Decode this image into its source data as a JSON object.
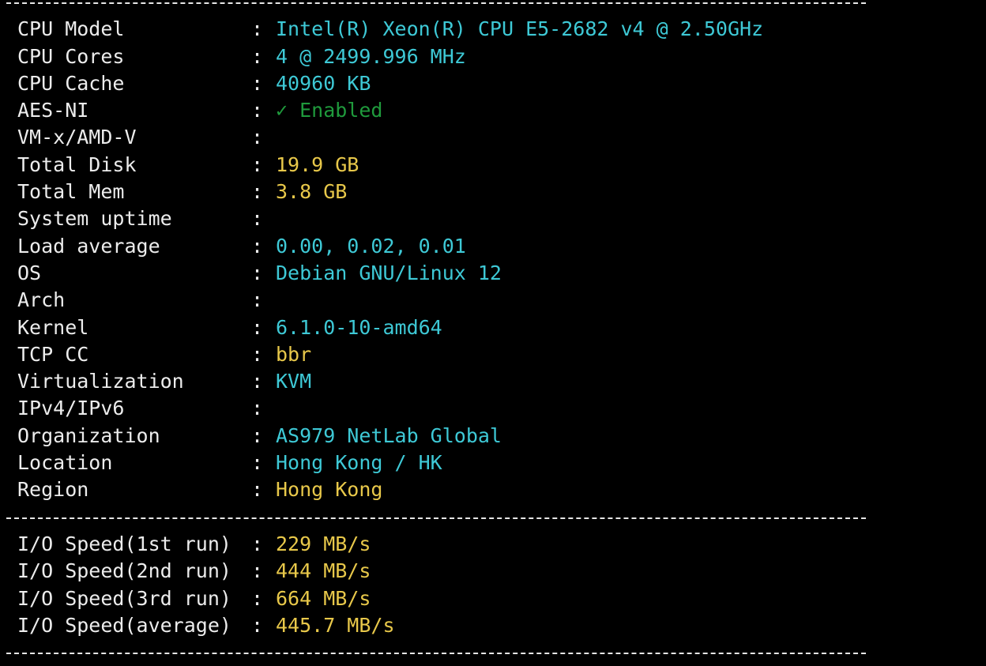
{
  "colors": {
    "background": "#000000",
    "label": "#ececec",
    "cyan": "#3ec9d6",
    "yellow": "#e8c84a",
    "green": "#1f9a3c"
  },
  "separator": "--------------------------------------------------------------------",
  "system_info": [
    {
      "label": "CPU Model",
      "value": "Intel(R) Xeon(R) CPU E5-2682 v4 @ 2.50GHz",
      "color": "cyan"
    },
    {
      "label": "CPU Cores",
      "value": "4 @ 2499.996 MHz",
      "color": "cyan"
    },
    {
      "label": "CPU Cache",
      "value": "40960 KB",
      "color": "cyan"
    },
    {
      "label": "AES-NI",
      "value": "✓ Enabled",
      "color": "green"
    },
    {
      "label": "VM-x/AMD-V",
      "value": "",
      "color": "cyan"
    },
    {
      "label": "Total Disk",
      "value": "19.9 GB",
      "color": "yellow"
    },
    {
      "label": "Total Mem",
      "value": "3.8 GB",
      "color": "yellow"
    },
    {
      "label": "System uptime",
      "value": "",
      "color": "cyan"
    },
    {
      "label": "Load average",
      "value": "0.00, 0.02, 0.01",
      "color": "cyan"
    },
    {
      "label": "OS",
      "value": "Debian GNU/Linux 12",
      "color": "cyan"
    },
    {
      "label": "Arch",
      "value": "",
      "color": "cyan"
    },
    {
      "label": "Kernel",
      "value": "6.1.0-10-amd64",
      "color": "cyan"
    },
    {
      "label": "TCP CC",
      "value": "bbr",
      "color": "yellow"
    },
    {
      "label": "Virtualization",
      "value": "KVM",
      "color": "cyan"
    },
    {
      "label": "IPv4/IPv6",
      "value": "",
      "color": "cyan"
    },
    {
      "label": "Organization",
      "value": "AS979 NetLab Global",
      "color": "cyan"
    },
    {
      "label": "Location",
      "value": "Hong Kong / HK",
      "color": "cyan"
    },
    {
      "label": "Region",
      "value": "Hong Kong",
      "color": "yellow"
    }
  ],
  "io_speed": [
    {
      "label": "I/O Speed(1st run)",
      "value": "229 MB/s",
      "color": "yellow"
    },
    {
      "label": "I/O Speed(2nd run)",
      "value": "444 MB/s",
      "color": "yellow"
    },
    {
      "label": "I/O Speed(3rd run)",
      "value": "664 MB/s",
      "color": "yellow"
    },
    {
      "label": "I/O Speed(average)",
      "value": "445.7 MB/s",
      "color": "yellow"
    }
  ]
}
